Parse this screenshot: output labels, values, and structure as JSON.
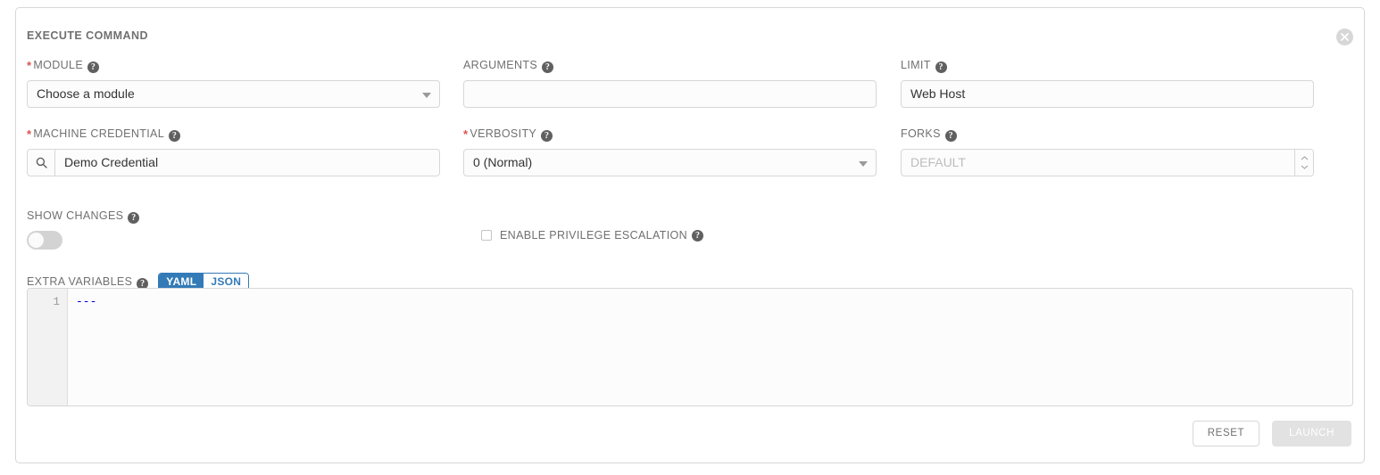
{
  "panel": {
    "title": "EXECUTE COMMAND",
    "close_icon": "close-circle-icon",
    "help_glyph": "?"
  },
  "fields": {
    "module": {
      "label": "MODULE",
      "required": true,
      "value": "Choose a module",
      "control": "select"
    },
    "arguments": {
      "label": "ARGUMENTS",
      "required": false,
      "value": "",
      "placeholder": "",
      "control": "text"
    },
    "limit": {
      "label": "LIMIT",
      "required": false,
      "value": "Web Host",
      "control": "text"
    },
    "machine_credential": {
      "label": "MACHINE CREDENTIAL",
      "required": true,
      "value": "Demo Credential",
      "control": "lookup",
      "prefix_icon": "search-icon"
    },
    "verbosity": {
      "label": "VERBOSITY",
      "required": true,
      "value": "0 (Normal)",
      "control": "select"
    },
    "forks": {
      "label": "FORKS",
      "required": false,
      "value": "",
      "placeholder": "DEFAULT",
      "control": "number"
    },
    "show_changes": {
      "label": "SHOW CHANGES",
      "state": "off"
    },
    "enable_privilege_escalation": {
      "label": "ENABLE PRIVILEGE ESCALATION",
      "checked": false
    },
    "extra_variables": {
      "label": "EXTRA VARIABLES",
      "format_yaml": "YAML",
      "format_json": "JSON",
      "active_format": "YAML",
      "line_number": "1",
      "content": "---"
    }
  },
  "footer": {
    "reset_label": "RESET",
    "launch_label": "LAUNCH",
    "launch_disabled": true
  },
  "colors": {
    "accent_blue": "#337ab7",
    "required_red": "#d9534f",
    "label_gray": "#707070",
    "border_gray": "#d7d7d7",
    "code_blue": "#0000d0"
  }
}
